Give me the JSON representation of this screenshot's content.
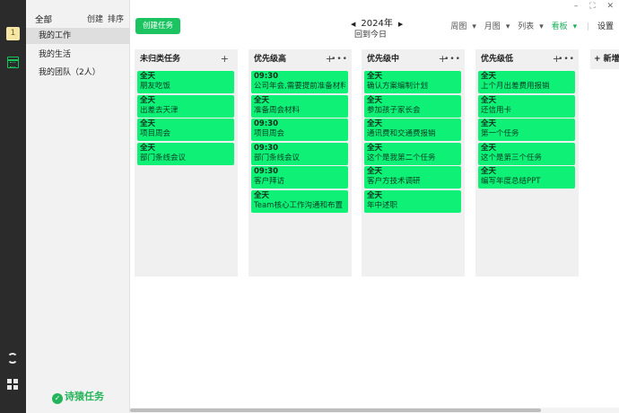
{
  "rail": {
    "badge": "1"
  },
  "sidebar": {
    "all": "全部",
    "create": "创建",
    "sort": "排序",
    "items": [
      "我的工作",
      "我的生活",
      "我的团队（2人）"
    ],
    "brand": "诗猿任务"
  },
  "toolbar": {
    "create_task": "创建任务",
    "year": "2024年",
    "back_today": "回到今日",
    "views": [
      "周图",
      "月图",
      "列表",
      "看板"
    ],
    "active_view": "看板",
    "settings": "设置"
  },
  "columns": [
    {
      "title": "未归类任务",
      "cards": [
        {
          "time": "全天",
          "text": "朋友吃饭"
        },
        {
          "time": "全天",
          "text": "出差去天津"
        },
        {
          "time": "全天",
          "text": "项目周会"
        },
        {
          "time": "全天",
          "text": "部门条线会议"
        }
      ]
    },
    {
      "title": "优先级高",
      "cards": [
        {
          "time": "09:30",
          "text": "公司年会,需要提前准备材料"
        },
        {
          "time": "全天",
          "text": "准备周会材料"
        },
        {
          "time": "09:30",
          "text": "项目周会"
        },
        {
          "time": "09:30",
          "text": "部门条线会议"
        },
        {
          "time": "09:30",
          "text": "客户拜访"
        },
        {
          "time": "全天",
          "text": "Team核心工作沟通和布置"
        }
      ]
    },
    {
      "title": "优先级中",
      "cards": [
        {
          "time": "全天",
          "text": "确认方案编制计划"
        },
        {
          "time": "全天",
          "text": "参加孩子家长会"
        },
        {
          "time": "全天",
          "text": "通讯费和交通费报销"
        },
        {
          "time": "全天",
          "text": "这个是我第二个任务"
        },
        {
          "time": "全天",
          "text": "客户方技术调研"
        },
        {
          "time": "全天",
          "text": "年中述职"
        }
      ]
    },
    {
      "title": "优先级低",
      "cards": [
        {
          "time": "全天",
          "text": "上个月出差费用报销"
        },
        {
          "time": "全天",
          "text": "还信用卡"
        },
        {
          "time": "全天",
          "text": "第一个任务"
        },
        {
          "time": "全天",
          "text": "这个是第三个任务"
        },
        {
          "time": "全天",
          "text": "编写年度总结PPT"
        }
      ]
    }
  ],
  "new_column": "+ 新增",
  "colors": {
    "accent": "#1cc461",
    "card": "#0ff077",
    "rail": "#2b2b2b"
  }
}
